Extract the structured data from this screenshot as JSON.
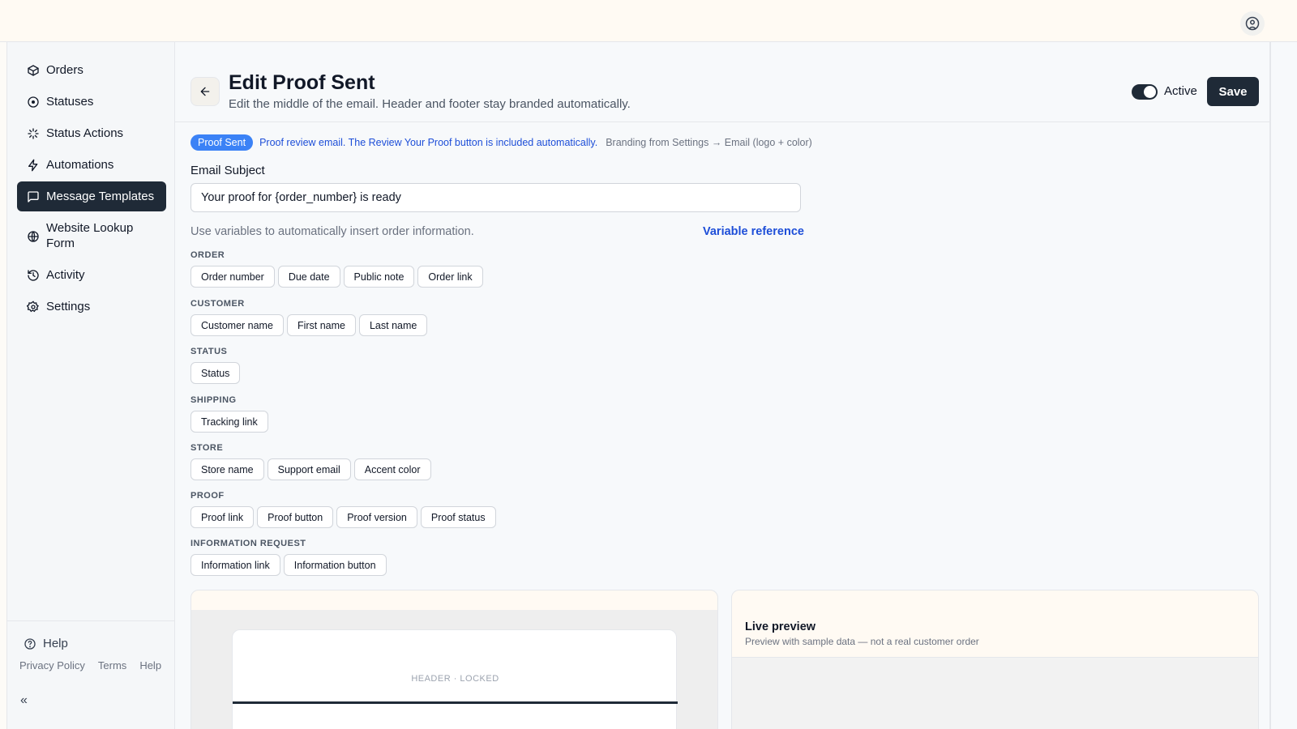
{
  "nav": {
    "items": [
      {
        "label": "Orders",
        "icon": "package-icon"
      },
      {
        "label": "Statuses",
        "icon": "status-circle-icon"
      },
      {
        "label": "Status Actions",
        "icon": "sparkle-icon"
      },
      {
        "label": "Automations",
        "icon": "lightning-icon"
      },
      {
        "label": "Message Templates",
        "icon": "message-square-icon",
        "active": true
      },
      {
        "label": "Website Lookup Form",
        "icon": "globe-icon"
      },
      {
        "label": "Activity",
        "icon": "history-icon"
      },
      {
        "label": "Settings",
        "icon": "gear-icon"
      }
    ],
    "help": "Help",
    "footer_links": [
      "Privacy Policy",
      "Terms",
      "Help"
    ],
    "collapse": "«"
  },
  "header": {
    "title": "Edit Proof Sent",
    "subtitle": "Edit the middle of the email. Header and footer stay branded automatically.",
    "toggle_label": "Active",
    "toggle_on": true,
    "save_label": "Save"
  },
  "info": {
    "tag": "Proof Sent",
    "description": "Proof review email. The Review Your Proof button is included automatically.",
    "branding": "Branding from Settings → Email (logo + color)"
  },
  "subject": {
    "label": "Email Subject",
    "value": "Your proof for {order_number} is ready"
  },
  "variables": {
    "hint": "Use variables to automatically insert order information.",
    "reference_link": "Variable reference",
    "groups": [
      {
        "title": "ORDER",
        "chips": [
          "Order number",
          "Due date",
          "Public note",
          "Order link"
        ]
      },
      {
        "title": "CUSTOMER",
        "chips": [
          "Customer name",
          "First name",
          "Last name"
        ]
      },
      {
        "title": "STATUS",
        "chips": [
          "Status"
        ]
      },
      {
        "title": "SHIPPING",
        "chips": [
          "Tracking link"
        ]
      },
      {
        "title": "STORE",
        "chips": [
          "Store name",
          "Support email",
          "Accent color"
        ]
      },
      {
        "title": "PROOF",
        "chips": [
          "Proof link",
          "Proof button",
          "Proof version",
          "Proof status"
        ]
      },
      {
        "title": "INFORMATION REQUEST",
        "chips": [
          "Information link",
          "Information button"
        ]
      }
    ]
  },
  "editor": {
    "header_label": "HEADER · LOCKED"
  },
  "preview": {
    "title": "Live preview",
    "subtitle": "Preview with sample data — not a real customer order"
  },
  "colors": {
    "primary": "#1f2a37",
    "accent_blue": "#3b82f6",
    "link_blue": "#1d4ed8"
  }
}
